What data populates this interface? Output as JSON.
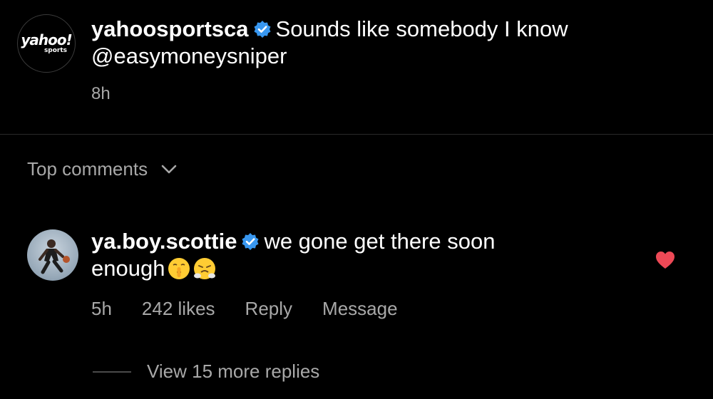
{
  "post": {
    "avatar_logo_main": "yahoo!",
    "avatar_logo_sub": "sports",
    "username": "yahoosportsca",
    "caption_line1": "Sounds like somebody I know",
    "caption_line2": "@easymoneysniper",
    "time": "8h"
  },
  "section": {
    "top_comments_label": "Top comments"
  },
  "comment": {
    "username": "ya.boy.scottie",
    "text_line1": "we gone get there soon",
    "text_line2": "enough",
    "emojis": [
      "shushing-face",
      "face-with-steam"
    ],
    "time": "5h",
    "likes": "242 likes",
    "reply_label": "Reply",
    "message_label": "Message",
    "liked": true,
    "view_replies_label": "View 15 more replies"
  },
  "colors": {
    "background": "#000000",
    "verified_badge": "#3897f0",
    "heart": "#ed4956",
    "secondary_text": "#a8a8a8"
  }
}
